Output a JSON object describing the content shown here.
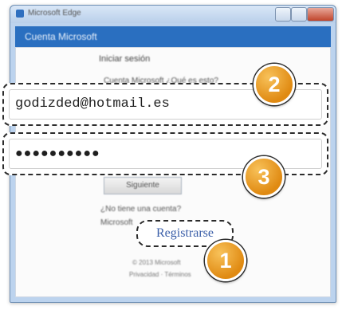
{
  "window": {
    "title": "Microsoft Edge",
    "header": "Cuenta Microsoft"
  },
  "content": {
    "signin_heading": "Iniciar sesión",
    "account_label": "Cuenta Microsoft ¿Qué es esto?",
    "next_button": "Siguiente",
    "no_account_text": "¿No tiene una cuenta?",
    "microsoft_account_text": "Microsoft",
    "footer_copyright": "© 2013 Microsoft",
    "footer_links": "Privacidad · Términos"
  },
  "form": {
    "email_value": "godizded@hotmail.es",
    "password_value": "●●●●●●●●●●"
  },
  "links": {
    "register": "Registrarse"
  },
  "callouts": {
    "badge_1": "1",
    "badge_2": "2",
    "badge_3": "3"
  },
  "colors": {
    "badge_orange": "#e08a12",
    "header_blue": "#2a6fc0",
    "link_blue": "#3a5ea8"
  }
}
